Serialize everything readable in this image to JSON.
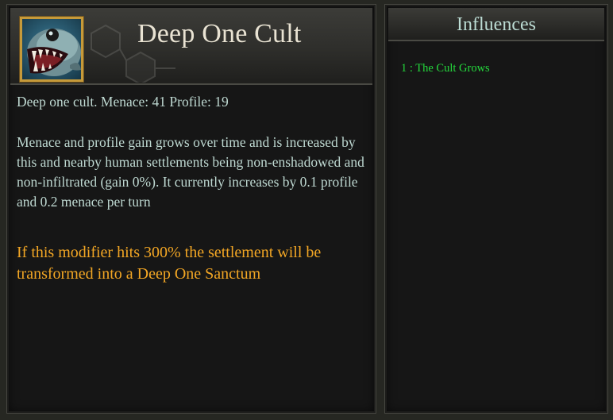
{
  "modifier_panel": {
    "title": "Deep One Cult",
    "portrait_icon": "deep-one-fish-portrait",
    "summary": "Deep one cult. Menace: 41 Profile: 19",
    "description": "Menace and profile gain grows over time and is increased by this and nearby human settlements being non-enshadowed and non-infiltrated (gain 0%). It currently increases by 0.1 profile and 0.2 menace per turn",
    "warning": "If this modifier hits 300% the settlement will be transformed into a Deep One Sanctum"
  },
  "influences_panel": {
    "title": "Influences",
    "items": [
      {
        "label": "1 : The Cult Grows"
      }
    ]
  },
  "colors": {
    "panel_bg": "#161616",
    "body_text": "#bfd9d2",
    "warning_text": "#f2a624",
    "influence_text": "#24d83c",
    "portrait_border": "#c69a3a"
  }
}
